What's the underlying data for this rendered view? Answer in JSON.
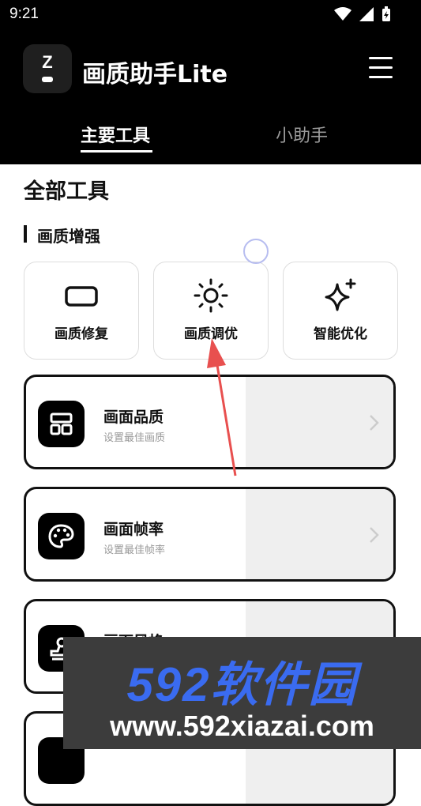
{
  "status": {
    "time": "9:21"
  },
  "app": {
    "title": "画质助手Lite"
  },
  "tabs": [
    {
      "label": "主要工具",
      "active": true
    },
    {
      "label": "小助手",
      "active": false
    }
  ],
  "section": {
    "title": "全部工具",
    "subtitle": "画质增强"
  },
  "tools": [
    {
      "label": "画质修复",
      "icon": "screen-rect-icon"
    },
    {
      "label": "画质调优",
      "icon": "sun-icon"
    },
    {
      "label": "智能优化",
      "icon": "sparkle-icon"
    }
  ],
  "features": [
    {
      "title": "画面品质",
      "subtitle": "设置最佳画质",
      "icon": "grid-layout-icon"
    },
    {
      "title": "画面帧率",
      "subtitle": "设置最佳帧率",
      "icon": "palette-icon"
    },
    {
      "title": "画面风格",
      "subtitle": "",
      "icon": "stamp-icon"
    },
    {
      "title": "",
      "subtitle": "",
      "icon": ""
    }
  ],
  "watermark": {
    "brand": "592软件园",
    "url": "www.592xiazai.com"
  },
  "colors": {
    "accent": "#000000",
    "watermark_blue": "#3a6bf0",
    "arrow": "#e8504f"
  }
}
